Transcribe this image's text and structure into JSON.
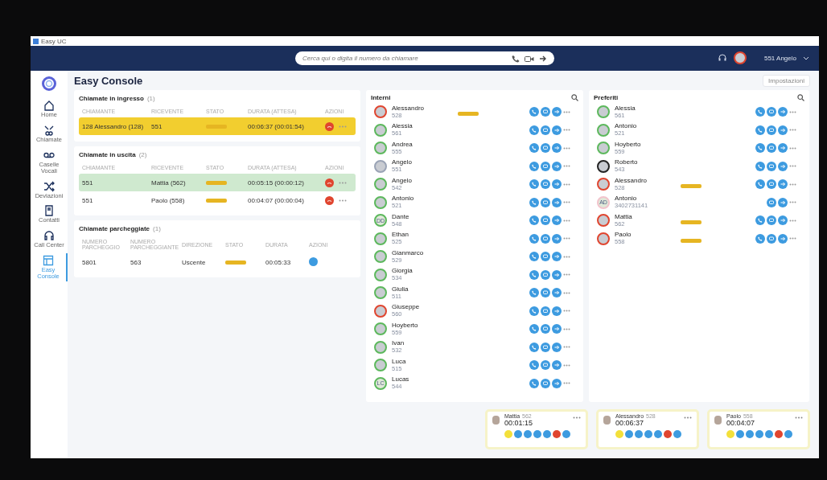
{
  "window": {
    "title": "Easy UC"
  },
  "topbar": {
    "search": {
      "placeholder": "Cerca qui o digita il numero da chiamare"
    },
    "user": "551 Angelo"
  },
  "sidebar": {
    "items": [
      {
        "label": "Home",
        "selected": false
      },
      {
        "label": "Chiamate",
        "selected": false
      },
      {
        "label": "Caselle Vocali",
        "selected": false
      },
      {
        "label": "Deviazioni",
        "selected": false
      },
      {
        "label": "Contatti",
        "selected": false
      },
      {
        "label": "Call Center",
        "selected": false
      },
      {
        "label": "Easy Console",
        "selected": true
      }
    ]
  },
  "page": {
    "title": "Easy Console",
    "settings_button": "Impostazioni"
  },
  "incoming": {
    "title": "Chiamate in ingresso",
    "count": "(1)",
    "columns": [
      "CHIAMANTE",
      "RICEVENTE",
      "STATO",
      "DURATA (ATTESA)",
      "AZIONI"
    ],
    "rows": [
      {
        "kind": "ringing",
        "cells": [
          "128 Alessandro (128)",
          "551",
          "",
          "00:06:37  (00:01:54)"
        ]
      }
    ]
  },
  "outgoing": {
    "title": "Chiamate in uscita",
    "count": "(2)",
    "columns": [
      "CHIAMANTE",
      "RICEVENTE",
      "STATO",
      "DURATA (ATTESA)",
      "AZIONI"
    ],
    "rows": [
      {
        "kind": "active",
        "cells": [
          "551",
          "Mattia  (562)",
          "",
          "00:05:15  (00:00:12)"
        ]
      },
      {
        "kind": "normal",
        "cells": [
          "551",
          "Paolo  (558)",
          "",
          "00:04:07  (00:00:04)"
        ]
      }
    ]
  },
  "parked": {
    "title": "Chiamate parcheggiate",
    "count": "(1)",
    "columns": [
      "NUMERO PARCHEGGIO",
      "NUMERO PARCHEGGIANTE",
      "DIREZIONE",
      "STATO",
      "DURATA",
      "AZIONI"
    ],
    "rows": [
      {
        "cells": [
          "5801",
          "563",
          "Uscente",
          "",
          "00:05:33"
        ]
      }
    ]
  },
  "internal": {
    "title": "Interni",
    "contacts": [
      {
        "name": "Alessandro",
        "ext": "528",
        "color": "#e0452f",
        "busy": true,
        "kind": "internal"
      },
      {
        "name": "Alessia",
        "ext": "561",
        "color": "#5cb85c",
        "busy": false,
        "kind": "internal"
      },
      {
        "name": "Andrea",
        "ext": "555",
        "color": "#5cb85c",
        "busy": false,
        "kind": "internal"
      },
      {
        "name": "Angelo",
        "ext": "551",
        "color": "#9aa3b5",
        "busy": false,
        "kind": "internal"
      },
      {
        "name": "Angelo",
        "ext": "542",
        "color": "#5cb85c",
        "busy": false,
        "kind": "internal"
      },
      {
        "name": "Antonio",
        "ext": "521",
        "color": "#5cb85c",
        "busy": false,
        "kind": "internal"
      },
      {
        "name": "Dante",
        "ext": "548",
        "color": "#5cb85c",
        "busy": false,
        "kind": "internal",
        "initials": "DD"
      },
      {
        "name": "Ethan",
        "ext": "525",
        "color": "#5cb85c",
        "busy": false,
        "kind": "internal"
      },
      {
        "name": "Gianmarco",
        "ext": "529",
        "color": "#5cb85c",
        "busy": false,
        "kind": "internal"
      },
      {
        "name": "Giorgia",
        "ext": "534",
        "color": "#5cb85c",
        "busy": false,
        "kind": "internal"
      },
      {
        "name": "Giulia",
        "ext": "511",
        "color": "#5cb85c",
        "busy": false,
        "kind": "internal"
      },
      {
        "name": "Giuseppe",
        "ext": "560",
        "color": "#e0452f",
        "busy": false,
        "kind": "internal"
      },
      {
        "name": "Hoyberto",
        "ext": "559",
        "color": "#5cb85c",
        "busy": false,
        "kind": "internal"
      },
      {
        "name": "Ivan",
        "ext": "532",
        "color": "#5cb85c",
        "busy": false,
        "kind": "internal"
      },
      {
        "name": "Luca",
        "ext": "515",
        "color": "#5cb85c",
        "busy": false,
        "kind": "internal"
      },
      {
        "name": "Lucas",
        "ext": "544",
        "color": "#5cb85c",
        "busy": false,
        "kind": "internal",
        "initials": "LC"
      }
    ]
  },
  "favorites": {
    "title": "Preferiti",
    "contacts": [
      {
        "name": "Alessia",
        "ext": "561",
        "color": "#5cb85c",
        "busy": false,
        "kind": "internal"
      },
      {
        "name": "Antonio",
        "ext": "521",
        "color": "#5cb85c",
        "busy": false,
        "kind": "internal"
      },
      {
        "name": "Hoyberto",
        "ext": "559",
        "color": "#5cb85c",
        "busy": false,
        "kind": "internal"
      },
      {
        "name": "Roberto",
        "ext": "543",
        "color": "#222222",
        "busy": false,
        "kind": "internal"
      },
      {
        "name": "Alessandro",
        "ext": "528",
        "color": "#e0452f",
        "busy": true,
        "kind": "internal"
      },
      {
        "name": "Antonio",
        "ext": "3402731141",
        "color": "#f2c4cc",
        "busy": false,
        "kind": "external",
        "initials": "AD"
      },
      {
        "name": "Mattia",
        "ext": "562",
        "color": "#e0452f",
        "busy": true,
        "kind": "internal"
      },
      {
        "name": "Paolo",
        "ext": "558",
        "color": "#e0452f",
        "busy": true,
        "kind": "internal"
      }
    ]
  },
  "active_calls": [
    {
      "name": "Mattia",
      "ext": "562",
      "time": "00:01:15"
    },
    {
      "name": "Alessandro",
      "ext": "528",
      "time": "00:06:37"
    },
    {
      "name": "Paolo",
      "ext": "558",
      "time": "00:04:07"
    }
  ]
}
